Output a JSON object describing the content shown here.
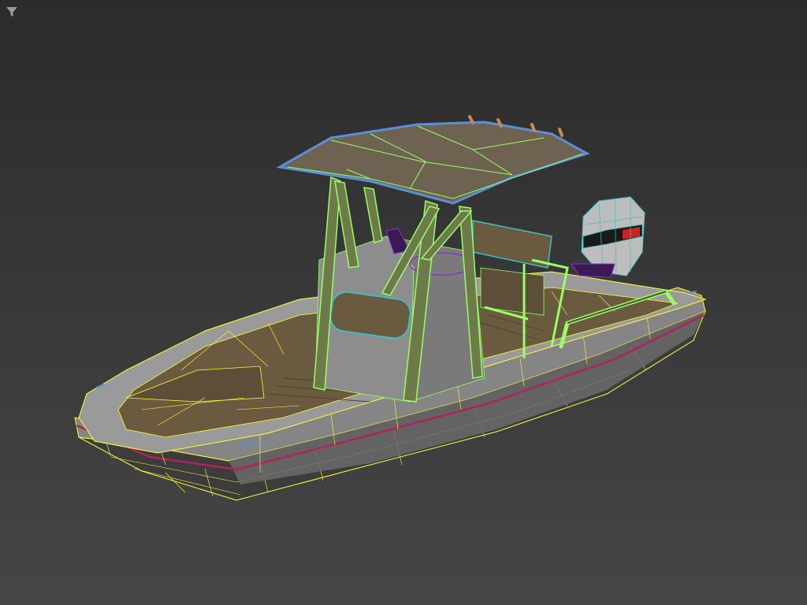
{
  "viewport": {
    "filter_icon": "filter-icon",
    "background_top": "#2b2b2b",
    "background_bottom": "#464646"
  },
  "model": {
    "name": "center-console-boat",
    "hull_fill": "#8a8a8a",
    "deck_fill": "#6a5a40",
    "wireframe_color": "#ffff33",
    "tower_wire_color": "#99ff66",
    "roof_edge_color": "#5a8fd8",
    "accent_stripe_color": "#b0245a",
    "engine_stripe_color": "#cc2222"
  }
}
